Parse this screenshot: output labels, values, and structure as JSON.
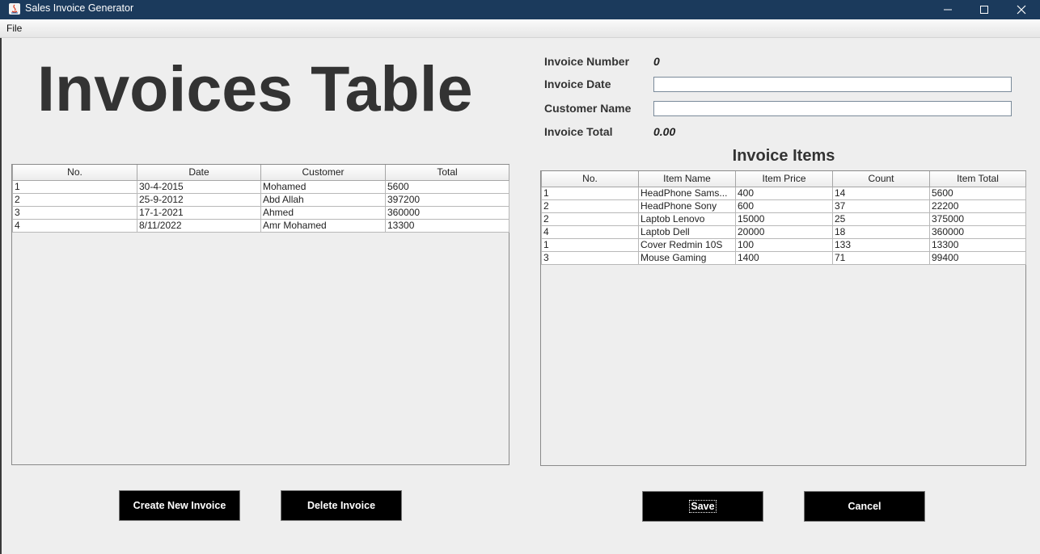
{
  "window": {
    "title": "Sales Invoice Generator",
    "icon": "java-icon",
    "controls": {
      "minimize": "minimize-icon",
      "maximize": "maximize-icon",
      "close": "close-icon"
    }
  },
  "menu": {
    "file": "File"
  },
  "left": {
    "heading": "Invoices Table",
    "table": {
      "columns": [
        "No.",
        "Date",
        "Customer",
        "Total"
      ],
      "rows": [
        [
          "1",
          "30-4-2015",
          "Mohamed",
          "5600"
        ],
        [
          "2",
          "25-9-2012",
          "Abd Allah",
          "397200"
        ],
        [
          "3",
          "17-1-2021",
          "Ahmed",
          "360000"
        ],
        [
          "4",
          "8/11/2022",
          "Amr Mohamed",
          "13300"
        ]
      ]
    },
    "buttons": {
      "create": "Create New Invoice",
      "delete": "Delete Invoice"
    }
  },
  "right": {
    "form": {
      "invoice_number_label": "Invoice Number",
      "invoice_number_value": "0",
      "invoice_date_label": "Invoice Date",
      "invoice_date_value": "",
      "customer_name_label": "Customer Name",
      "customer_name_value": "",
      "invoice_total_label": "Invoice Total",
      "invoice_total_value": "0.00"
    },
    "items_heading": "Invoice Items",
    "table": {
      "columns": [
        "No.",
        "Item Name",
        "Item Price",
        "Count",
        "Item Total"
      ],
      "rows": [
        [
          "1",
          "HeadPhone Sams...",
          "400",
          "14",
          "5600"
        ],
        [
          "2",
          "HeadPhone Sony",
          "600",
          "37",
          "22200"
        ],
        [
          "2",
          "Laptob Lenovo",
          "15000",
          "25",
          "375000"
        ],
        [
          "4",
          "Laptob Dell",
          "20000",
          "18",
          "360000"
        ],
        [
          "1",
          "Cover Redmin 10S",
          "100",
          "133",
          "13300"
        ],
        [
          "3",
          "Mouse Gaming",
          "1400",
          "71",
          "99400"
        ]
      ]
    },
    "buttons": {
      "save": "Save",
      "cancel": "Cancel"
    }
  },
  "colors": {
    "titlebar": "#1b3a5c",
    "button_bg": "#000000",
    "window_bg": "#eeeeee"
  }
}
